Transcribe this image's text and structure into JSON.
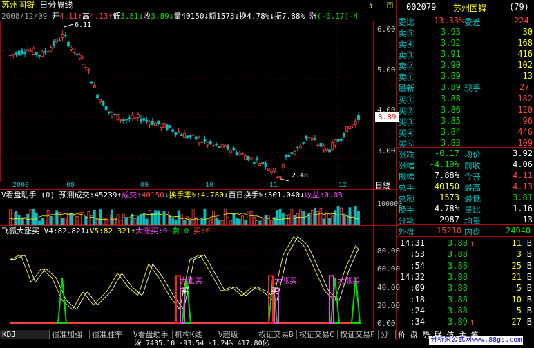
{
  "stock": {
    "name": "苏州固锝",
    "period": "日分隔线",
    "code": "002079",
    "rank": "(79)"
  },
  "ohlc_bar": {
    "date": "2008/12/09",
    "open_label": "开",
    "open": "4.11",
    "high_label": "高",
    "high": "4.13",
    "low_label": "低",
    "low": "3.81",
    "close_label": "收",
    "close": "3.89",
    "vol_label": "量",
    "vol": "40150",
    "amt_label": "额",
    "amt": "1573",
    "turn_label": "换",
    "turn": "4.78%",
    "amp_label": "振",
    "amp": "7.88%",
    "chg_label": "涨",
    "chg": "(-0.17)-4"
  },
  "price_axis": {
    "labels": [
      "6.00",
      "5.00",
      "4.00",
      "3.00"
    ],
    "current": "3.89",
    "high_mark": "6.11",
    "low_mark": "2.48"
  },
  "date_axis": {
    "labels": [
      "2008",
      "08",
      "09",
      "10",
      "11",
      "12"
    ],
    "right": "日线"
  },
  "vol_panel": {
    "title": "V看盘助手 (0)",
    "predict_label": "预测成交:",
    "predict": "45239",
    "deal_label": "成交:",
    "deal": "40150",
    "turn_label": "换手率%:",
    "turn": "4.780",
    "hundred_label": "百日换手%:",
    "hundred": "301.040",
    "gain_label": "收益:",
    "gain": "0.03",
    "axis_label": "100000"
  },
  "osc_panel": {
    "title": "飞狐大涨买",
    "v4_label": "V4:",
    "v4": "82.821",
    "v5_label": "V5:",
    "v5": "82.321",
    "buy_label": "大涨买:",
    "buy": "0",
    "sell1_label": "卖:",
    "sell1": "0",
    "sell2_label": "买:",
    "sell2": "0",
    "axis": [
      "80.00",
      "60.00",
      "40.00",
      "20.00",
      "0.00"
    ],
    "signal_labels": [
      "大涨买",
      "大涨买",
      "大涨买"
    ],
    "buy_text": "买"
  },
  "tabs": [
    "KDJ",
    "很准加强",
    "很准胜率",
    "V看盘助手",
    "机构K线(修",
    "V超级MACD",
    "权证交易B",
    "权证交易C",
    "权证交易F",
    "分隔"
  ],
  "quote": {
    "weibi_label": "委比",
    "weibi": "13.33%",
    "weicha_label": "委差",
    "weicha": "224",
    "sells": [
      {
        "label": "卖⑤",
        "price": "3.93",
        "vol": "30"
      },
      {
        "label": "卖④",
        "price": "3.92",
        "vol": "168"
      },
      {
        "label": "卖③",
        "price": "3.91",
        "vol": "416"
      },
      {
        "label": "卖②",
        "price": "3.90",
        "vol": "102"
      },
      {
        "label": "卖①",
        "price": "3.89",
        "vol": "13"
      }
    ],
    "latest_label": "最新",
    "latest": "3.89",
    "now_hand_label": "现手",
    "now_hand": "27",
    "buys": [
      {
        "label": "买①",
        "price": "3.88",
        "vol": "182"
      },
      {
        "label": "买②",
        "price": "3.86",
        "vol": "120"
      },
      {
        "label": "买③",
        "price": "3.85",
        "vol": "96"
      },
      {
        "label": "买④",
        "price": "3.84",
        "vol": "446"
      },
      {
        "label": "买⑤",
        "price": "3.83",
        "vol": "109"
      }
    ],
    "stats": [
      {
        "l1": "涨跌",
        "v1": "-0.17",
        "l2": "均价",
        "v2": "3.92"
      },
      {
        "l1": "涨幅",
        "v1": "-4.19%",
        "l2": "前收",
        "v2": "4.06"
      },
      {
        "l1": "振幅",
        "v1": "7.88%",
        "l2": "今开",
        "v2": "4.11"
      },
      {
        "l1": "总手",
        "v1": "40150",
        "l2": "最高",
        "v2": "4.13"
      },
      {
        "l1": "总额",
        "v1": "1573",
        "l2": "最低",
        "v2": "3.81"
      },
      {
        "l1": "换手",
        "v1": "4.78%",
        "l2": "量比",
        "v2": "1.16"
      },
      {
        "l1": "分笔",
        "v1": "2987",
        "l2": "均量",
        "v2": "13"
      }
    ],
    "outer_label": "外盘",
    "outer": "15210",
    "inner_label": "内盘",
    "inner": "24940"
  },
  "ticks": [
    {
      "time": "14:31",
      "price": "3.88",
      "arrow": "↑",
      "vol": "11",
      "side": "B"
    },
    {
      "time": ":53",
      "price": "3.88",
      "arrow": "",
      "vol": "3",
      "side": "B"
    },
    {
      "time": ":54",
      "price": "3.88",
      "arrow": "",
      "vol": "25",
      "side": "B"
    },
    {
      "time": "14:32",
      "price": "3.88",
      "arrow": "",
      "vol": "21",
      "side": "B"
    },
    {
      "time": ":09",
      "price": "3.88",
      "arrow": "",
      "vol": "5",
      "side": "B"
    },
    {
      "time": ":18",
      "price": "3.88",
      "arrow": "",
      "vol": "10",
      "side": "B"
    },
    {
      "time": ":24",
      "price": "3.88",
      "arrow": "",
      "vol": "5",
      "side": "B"
    },
    {
      "time": ":34",
      "price": "3.89",
      "arrow": "↑",
      "vol": "27",
      "side": "B"
    }
  ],
  "bottom_right": "价 盘 势 联 值 主 筹 ...",
  "watermark": "分析家公式网www.88gs.com",
  "status_text": "深 7435.10 -93.54 -1.24% 417.80亿",
  "colors": {
    "up": "#ff4040",
    "down": "#00c0c0",
    "frame": "#b00000",
    "yellow": "#ffff00"
  }
}
